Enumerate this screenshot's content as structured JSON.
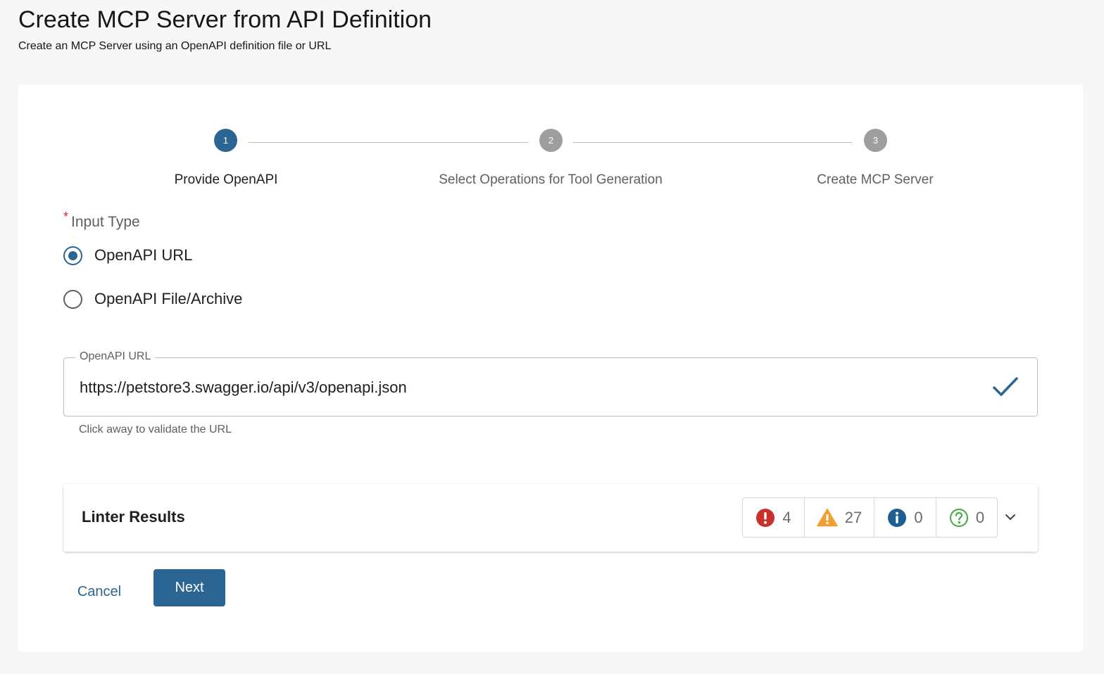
{
  "page": {
    "title": "Create MCP Server from API Definition",
    "subtitle": "Create an MCP Server using an OpenAPI definition file or URL"
  },
  "stepper": {
    "steps": [
      {
        "number": "1",
        "label": "Provide OpenAPI",
        "state": "active"
      },
      {
        "number": "2",
        "label": "Select Operations for Tool Generation",
        "state": "inactive"
      },
      {
        "number": "3",
        "label": "Create MCP Server",
        "state": "inactive"
      }
    ]
  },
  "input_type": {
    "required_marker": "*",
    "label": "Input Type",
    "options": [
      {
        "label": "OpenAPI URL",
        "selected": true
      },
      {
        "label": "OpenAPI File/Archive",
        "selected": false
      }
    ]
  },
  "url_field": {
    "label": "OpenAPI URL",
    "value": "https://petstore3.swagger.io/api/v3/openapi.json",
    "helper_text": "Click away to validate the URL",
    "status_icon": "check-icon"
  },
  "linter": {
    "title": "Linter Results",
    "badges": [
      {
        "type": "error",
        "icon": "error-icon",
        "count": "4",
        "color": "#c9302c"
      },
      {
        "type": "warning",
        "icon": "warning-icon",
        "count": "27",
        "color": "#f0a030"
      },
      {
        "type": "info",
        "icon": "info-icon",
        "count": "0",
        "color": "#1d5e95"
      },
      {
        "type": "hint",
        "icon": "help-icon",
        "count": "0",
        "color": "#4caf50"
      }
    ]
  },
  "actions": {
    "cancel_label": "Cancel",
    "next_label": "Next"
  },
  "colors": {
    "accent": "#2b6593",
    "required": "#c62828",
    "inactive_step": "#9e9e9e"
  }
}
